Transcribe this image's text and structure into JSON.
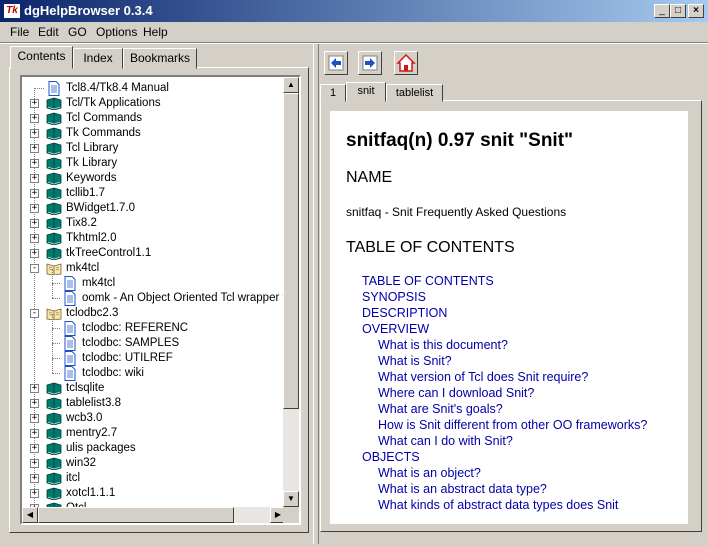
{
  "window": {
    "title": "dgHelpBrowser 0.3.4",
    "app_icon_text": "Tk",
    "controls": {
      "minimize": "_",
      "maximize": "□",
      "close": "×"
    }
  },
  "menu": [
    "File",
    "Edit",
    "GO",
    "Options",
    "Help"
  ],
  "left_tabs": [
    "Contents",
    "Index",
    "Bookmarks"
  ],
  "tree": [
    {
      "label": "Tcl8.4/Tk8.4 Manual",
      "type": "doc",
      "level": 0,
      "expander": ""
    },
    {
      "label": "Tcl/Tk Applications",
      "type": "book",
      "level": 0,
      "expander": "+"
    },
    {
      "label": "Tcl Commands",
      "type": "book",
      "level": 0,
      "expander": "+"
    },
    {
      "label": "Tk Commands",
      "type": "book",
      "level": 0,
      "expander": "+"
    },
    {
      "label": "Tcl Library",
      "type": "book",
      "level": 0,
      "expander": "+"
    },
    {
      "label": "Tk Library",
      "type": "book",
      "level": 0,
      "expander": "+"
    },
    {
      "label": "Keywords",
      "type": "book",
      "level": 0,
      "expander": "+"
    },
    {
      "label": "tcllib1.7",
      "type": "book",
      "level": 0,
      "expander": "+"
    },
    {
      "label": "BWidget1.7.0",
      "type": "book",
      "level": 0,
      "expander": "+"
    },
    {
      "label": "Tix8.2",
      "type": "book",
      "level": 0,
      "expander": "+"
    },
    {
      "label": "Tkhtml2.0",
      "type": "book",
      "level": 0,
      "expander": "+"
    },
    {
      "label": "tkTreeControl1.1",
      "type": "book",
      "level": 0,
      "expander": "+"
    },
    {
      "label": "mk4tcl",
      "type": "openbook",
      "level": 0,
      "expander": "-"
    },
    {
      "label": "mk4tcl",
      "type": "doc",
      "level": 1,
      "expander": ""
    },
    {
      "label": "oomk - An Object Oriented Tcl wrapper for M",
      "type": "doc",
      "level": 1,
      "expander": ""
    },
    {
      "label": "tclodbc2.3",
      "type": "openbook",
      "level": 0,
      "expander": "-"
    },
    {
      "label": "tclodbc: REFERENC",
      "type": "doc",
      "level": 1,
      "expander": ""
    },
    {
      "label": "tclodbc: SAMPLES",
      "type": "doc",
      "level": 1,
      "expander": ""
    },
    {
      "label": "tclodbc: UTILREF",
      "type": "doc",
      "level": 1,
      "expander": ""
    },
    {
      "label": "tclodbc: wiki",
      "type": "doc",
      "level": 1,
      "expander": ""
    },
    {
      "label": "tclsqlite",
      "type": "book",
      "level": 0,
      "expander": "+"
    },
    {
      "label": "tablelist3.8",
      "type": "book",
      "level": 0,
      "expander": "+"
    },
    {
      "label": "wcb3.0",
      "type": "book",
      "level": 0,
      "expander": "+"
    },
    {
      "label": "mentry2.7",
      "type": "book",
      "level": 0,
      "expander": "+"
    },
    {
      "label": "ulis packages",
      "type": "book",
      "level": 0,
      "expander": "+"
    },
    {
      "label": "win32",
      "type": "book",
      "level": 0,
      "expander": "+"
    },
    {
      "label": "itcl",
      "type": "book",
      "level": 0,
      "expander": "+"
    },
    {
      "label": "xotcl1.1.1",
      "type": "book",
      "level": 0,
      "expander": "+"
    },
    {
      "label": "Otcl",
      "type": "book",
      "level": 0,
      "expander": "+"
    }
  ],
  "scrollbar": {
    "up": "▲",
    "down": "▼",
    "left": "◀",
    "right": "▶"
  },
  "right_tabs": [
    "1",
    "snit",
    "tablelist"
  ],
  "document": {
    "title": "snitfaq(n) 0.97 snit \"Snit\"",
    "name_heading": "NAME",
    "name_text": "snitfaq - Snit Frequently Asked Questions",
    "toc_heading": "TABLE OF CONTENTS",
    "toc": [
      {
        "text": "TABLE OF CONTENTS",
        "level": 0
      },
      {
        "text": "SYNOPSIS",
        "level": 0
      },
      {
        "text": "DESCRIPTION",
        "level": 0
      },
      {
        "text": "OVERVIEW",
        "level": 0
      },
      {
        "text": "What is this document?",
        "level": 1
      },
      {
        "text": "What is Snit?",
        "level": 1
      },
      {
        "text": "What version of Tcl does Snit require?",
        "level": 1
      },
      {
        "text": "Where can I download Snit?",
        "level": 1
      },
      {
        "text": "What are Snit's goals?",
        "level": 1
      },
      {
        "text": "How is Snit different from other OO frameworks?",
        "level": 1
      },
      {
        "text": "What can I do with Snit?",
        "level": 1
      },
      {
        "text": "OBJECTS",
        "level": 0
      },
      {
        "text": "What is an object?",
        "level": 1
      },
      {
        "text": "What is an abstract data type?",
        "level": 1
      },
      {
        "text": "What kinds of abstract data types does Snit",
        "level": 1
      }
    ]
  },
  "colors": {
    "title_gradient_start": "#0a246a",
    "title_gradient_end": "#a6caf0",
    "link": "#0000a8",
    "book_green": "#007a6e",
    "doc_blue": "#2050c8",
    "home_red": "#d01818"
  }
}
